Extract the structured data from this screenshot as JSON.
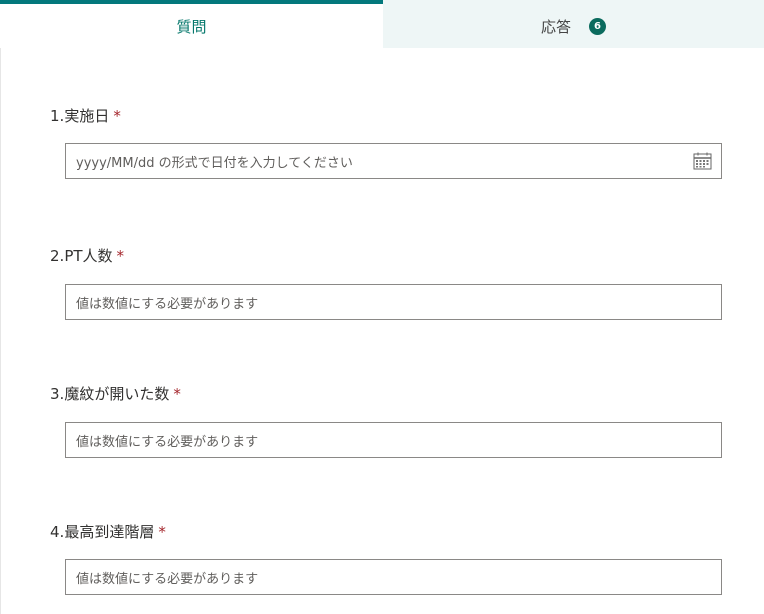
{
  "tabs": {
    "questions_label": "質問",
    "responses_label": "応答",
    "responses_count": "6"
  },
  "required_mark": "*",
  "questions": [
    {
      "number": "1.",
      "title": "実施日",
      "placeholder": "yyyy/MM/dd の形式で日付を入力してください",
      "icon": "calendar-icon"
    },
    {
      "number": "2.",
      "title": "PT人数",
      "placeholder": "値は数値にする必要があります"
    },
    {
      "number": "3.",
      "title": "魔紋が開いた数",
      "placeholder": "値は数値にする必要があります"
    },
    {
      "number": "4.",
      "title": "最高到達階層",
      "placeholder": "値は数値にする必要があります"
    }
  ],
  "colors": {
    "accent": "#03787c",
    "required": "#a4262c",
    "badge": "#0b6b5e"
  }
}
